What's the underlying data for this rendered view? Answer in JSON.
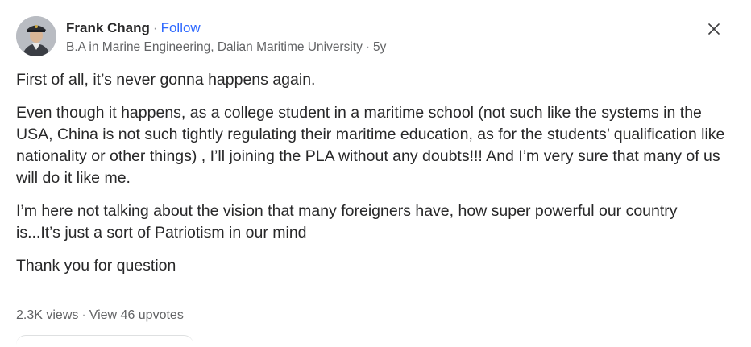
{
  "author": {
    "name": "Frank Chang",
    "separator": "·",
    "follow_label": "Follow",
    "credential": "B.A in Marine Engineering, Dalian Maritime University",
    "age": "5y"
  },
  "answer": {
    "paragraphs": [
      "First of all, it’s never gonna happens again.",
      "Even though it happens, as a college student in a maritime school (not such like the systems in the USA, China is not such tightly regulating their maritime education, as for the students’ qualification like nationality or other things) , I’ll joining the PLA without any doubts!!! And I’m very sure that many of us will do it like me.",
      "I’m here not talking about the vision that many foreigners have, how super powerful our country is...It’s just a sort of Patriotism in our mind",
      "Thank you for question"
    ]
  },
  "stats": {
    "views": "2.3K views",
    "separator": "·",
    "upvotes_link": "View 46 upvotes"
  },
  "icons": {
    "close": "close-icon",
    "avatar": "avatar"
  },
  "colors": {
    "link": "#2e69ff",
    "text": "#282829",
    "muted": "#636466"
  }
}
